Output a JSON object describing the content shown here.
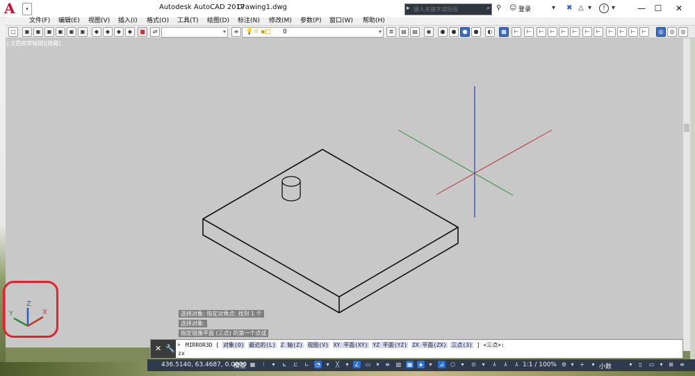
{
  "window": {
    "app_title": "Autodesk AutoCAD 2017",
    "doc_title": "Drawing1.dwg",
    "search_placeholder": "键入关键字或短语",
    "login_label": "登录",
    "help_label": "?"
  },
  "menu": [
    "文件(F)",
    "编辑(E)",
    "视图(V)",
    "插入(I)",
    "格式(O)",
    "工具(T)",
    "绘图(D)",
    "标注(N)",
    "修改(M)",
    "参数(P)",
    "窗口(W)",
    "帮助(H)"
  ],
  "toolbar": {
    "layer_value": "0"
  },
  "viewport": {
    "label": "[-][西南等轴测][隐藏]",
    "ucs_axes": {
      "x": "X",
      "y": "Y",
      "z": "Z"
    }
  },
  "command_history": [
    "选择对象: 指定对角点: 找到 1 个",
    "选择对象:",
    "指定镜像平面 (三点) 的第一个点或"
  ],
  "command_line": {
    "command": "MIRROR3D",
    "options": [
      {
        "text": "对象(O)"
      },
      {
        "text": "最近的(L)"
      },
      {
        "text": "Z 轴(Z)"
      },
      {
        "text": "视图(V)"
      },
      {
        "text": "XY 平面(XY)"
      },
      {
        "text": "YZ 平面(YZ)"
      },
      {
        "text": "ZX 平面(ZX)"
      },
      {
        "text": "三点(3)"
      }
    ],
    "default": "<三点>:",
    "input": "zx"
  },
  "statusbar": {
    "coordinates": "436.5140, 63.4687, 0.0000",
    "model_tab": "模型",
    "scale": "1:1 / 100%",
    "units": "小数"
  },
  "colors": {
    "ucs_x": "#c0392b",
    "ucs_y": "#2e8b3a",
    "ucs_z": "#2b59c3",
    "viewport_bg": "#c8c8c8",
    "status_bg": "#2f3a4c"
  }
}
